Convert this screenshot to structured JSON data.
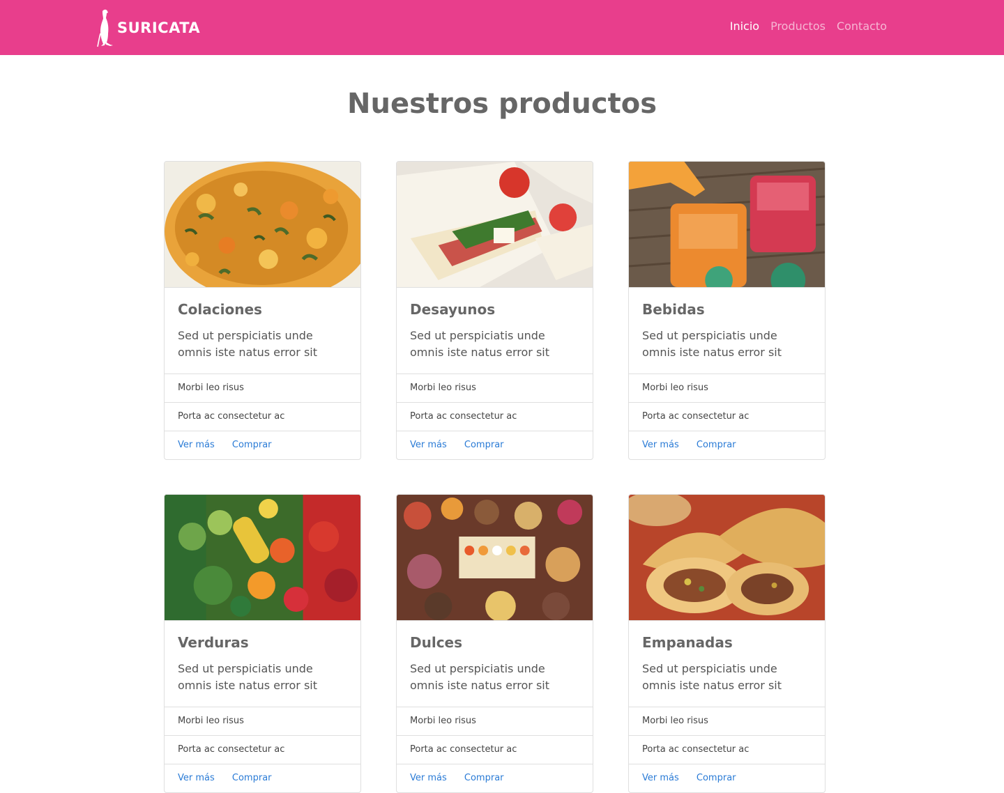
{
  "brand": {
    "name": "SURICATA"
  },
  "nav": {
    "items": [
      {
        "label": "Inicio",
        "active": true
      },
      {
        "label": "Productos",
        "active": false
      },
      {
        "label": "Contacto",
        "active": false
      }
    ]
  },
  "page": {
    "title": "Nuestros productos"
  },
  "colors": {
    "navbar": "#e83e8c",
    "link": "#2a7bd6"
  },
  "products": [
    {
      "title": "Colaciones",
      "text": "Sed ut perspiciatis unde omnis iste natus error sit",
      "list": [
        "Morbi leo risus",
        "Porta ac consectetur ac"
      ],
      "links": [
        "Ver más",
        "Comprar"
      ]
    },
    {
      "title": "Desayunos",
      "text": "Sed ut perspiciatis unde omnis iste natus error sit",
      "list": [
        "Morbi leo risus",
        "Porta ac consectetur ac"
      ],
      "links": [
        "Ver más",
        "Comprar"
      ]
    },
    {
      "title": "Bebidas",
      "text": "Sed ut perspiciatis unde omnis iste natus error sit",
      "list": [
        "Morbi leo risus",
        "Porta ac consectetur ac"
      ],
      "links": [
        "Ver más",
        "Comprar"
      ]
    },
    {
      "title": "Verduras",
      "text": "Sed ut perspiciatis unde omnis iste natus error sit",
      "list": [
        "Morbi leo risus",
        "Porta ac consectetur ac"
      ],
      "links": [
        "Ver más",
        "Comprar"
      ]
    },
    {
      "title": "Dulces",
      "text": "Sed ut perspiciatis unde omnis iste natus error sit",
      "list": [
        "Morbi leo risus",
        "Porta ac consectetur ac"
      ],
      "links": [
        "Ver más",
        "Comprar"
      ]
    },
    {
      "title": "Empanadas",
      "text": "Sed ut perspiciatis unde omnis iste natus error sit",
      "list": [
        "Morbi leo risus",
        "Porta ac consectetur ac"
      ],
      "links": [
        "Ver más",
        "Comprar"
      ]
    }
  ]
}
